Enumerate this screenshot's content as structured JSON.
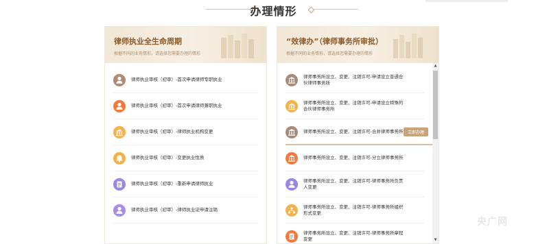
{
  "section": {
    "title": "办理情形"
  },
  "left_panel": {
    "title": "律师执业全生命周期",
    "subtitle": "根据不同的业务情形，请选择您需要办理的情形",
    "items": [
      {
        "label": "律师执业审核（初审）-首次申请律师专职执业",
        "icon": "person-icon",
        "color": "#b08a73"
      },
      {
        "label": "律师执业审核（初审）-首次申请律师兼职执业",
        "icon": "person-icon",
        "color": "#f27a3b"
      },
      {
        "label": "律师执业审核（初审）-律师执业机构变更",
        "icon": "building-icon",
        "color": "#f5b14a"
      },
      {
        "label": "律师执业审核（初审）-变更执业性质",
        "icon": "bell-icon",
        "color": "#f5b14a"
      },
      {
        "label": "律师执业审核（初审）-重新申请律师执业",
        "icon": "document-icon",
        "color": "#9b86e6"
      },
      {
        "label": "律师执业审核（初审）-律师执业证申请注销",
        "icon": "person-icon",
        "color": "#a88de8"
      }
    ]
  },
  "right_panel": {
    "title": "“效律办”（律师事务所审批）",
    "subtitle": "根据不同的业务情形，请选择您需要办理的情形",
    "hover_button": "立即办理",
    "items": [
      {
        "label": "律师事务所设立、变更、注销许可-申请设立普通合伙律师事务所",
        "icon": "court-icon",
        "color": "#a88a78"
      },
      {
        "label": "律师事务所设立、变更、注销许可-申请设立特殊的合伙律师事务所",
        "icon": "building-icon",
        "color": "#f5b14a"
      },
      {
        "label": "律师事务所设立、变更、注销许可-合并律师事务所",
        "icon": "court-icon",
        "color": "#a88a78"
      },
      {
        "label": "律师事务所设立、变更、注销许可-分立律师事务所",
        "icon": "court-icon",
        "color": "#f27a3b"
      },
      {
        "label": "律师事务所设立、变更、注销许可-律师事务所负责人变更",
        "icon": "person-icon",
        "color": "#9b86e6"
      },
      {
        "label": "律师事务所设立、变更、注销许可-律师事务所组织形式变更",
        "icon": "org-icon",
        "color": "#f5b14a"
      },
      {
        "label": "律师事务所设立、变更、注销许可-律师事务所章程变更",
        "icon": "document-icon",
        "color": "#f27a3b"
      }
    ]
  },
  "watermark": "央广网"
}
